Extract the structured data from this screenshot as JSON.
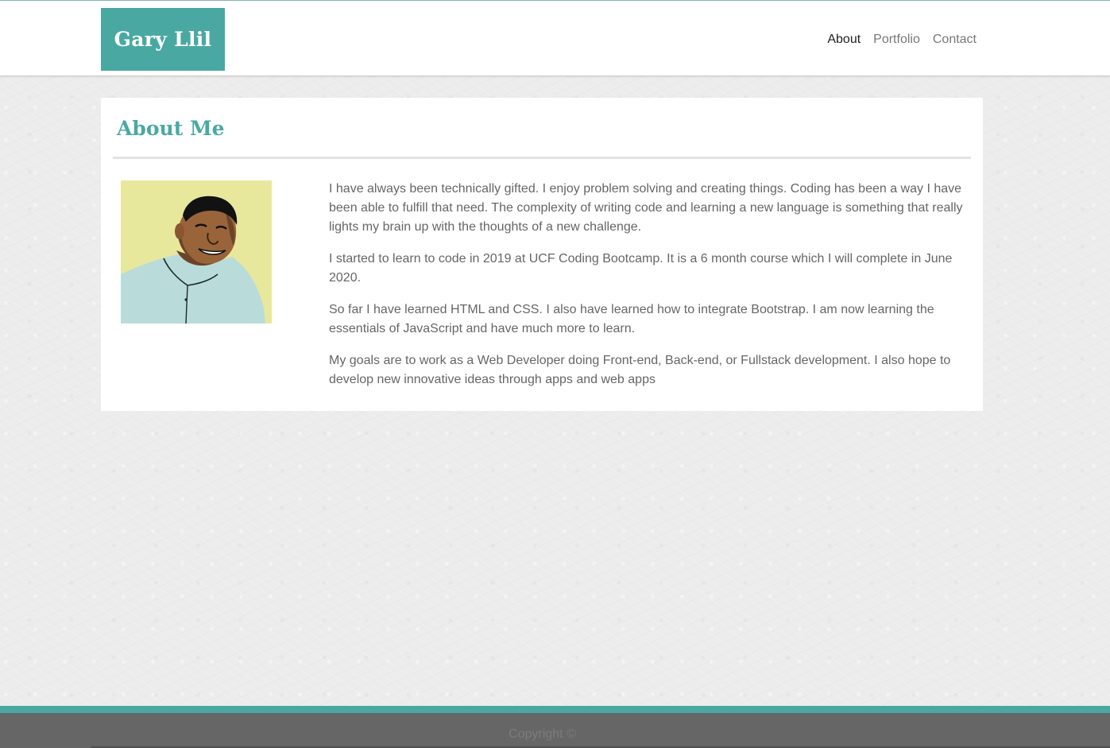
{
  "header": {
    "brand": "Gary Llil",
    "nav": [
      {
        "label": "About",
        "active": true
      },
      {
        "label": "Portfolio",
        "active": false
      },
      {
        "label": "Contact",
        "active": false
      }
    ]
  },
  "about": {
    "title": "About Me",
    "paragraphs": [
      "I have always been technically gifted. I enjoy problem solving and creating things. Coding has been a way I have been able to fulfill that need. The complexity of writing code and learning a new language is something that really lights my brain up with the thoughts of a new challenge.",
      "I started to learn to code in 2019 at UCF Coding Bootcamp. It is a 6 month course which I will complete in June 2020.",
      "So far I have learned HTML and CSS. I also have learned how to integrate Bootstrap. I am now learning the essentials of JavaScript and have much more to learn.",
      "My goals are to work as a Web Developer doing Front-end, Back-end, or Fullstack development. I also hope to develop new innovative ideas through apps and web apps"
    ]
  },
  "footer": {
    "copyright": "Copyright ©"
  },
  "colors": {
    "accent": "#4aa8a3",
    "footer": "#666666",
    "avatar_background": "#e8e89c",
    "shirt": "#b9dcdb"
  }
}
